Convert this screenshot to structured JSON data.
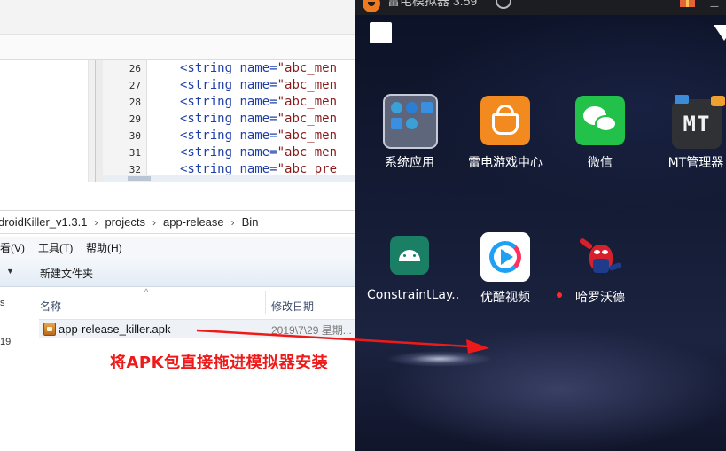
{
  "editor": {
    "lines": [
      {
        "num": "26",
        "prefix": "<string ",
        "attr": "name=",
        "value": "\"abc_men"
      },
      {
        "num": "27",
        "prefix": "<string ",
        "attr": "name=",
        "value": "\"abc_men"
      },
      {
        "num": "28",
        "prefix": "<string ",
        "attr": "name=",
        "value": "\"abc_men"
      },
      {
        "num": "29",
        "prefix": "<string ",
        "attr": "name=",
        "value": "\"abc_men"
      },
      {
        "num": "30",
        "prefix": "<string ",
        "attr": "name=",
        "value": "\"abc_men"
      },
      {
        "num": "31",
        "prefix": "<string ",
        "attr": "name=",
        "value": "\"abc_men"
      },
      {
        "num": "32",
        "prefix": "<string ",
        "attr": "name=",
        "value": "\"abc pre"
      }
    ]
  },
  "explorer": {
    "breadcrumb": [
      "droidKiller_v1.3.1",
      "projects",
      "app-release",
      "Bin"
    ],
    "breadcrumb_sep": "›",
    "menu": [
      "看(V)",
      "工具(T)",
      "帮助(H)"
    ],
    "toolbar": {
      "dropdown_glyph": "▼",
      "new_folder": "新建文件夹"
    },
    "nav_fragments": [
      "s",
      "19"
    ],
    "columns": {
      "name": "名称",
      "date": "修改日期",
      "sort_glyph": "^"
    },
    "files": [
      {
        "name": "app-release_killer.apk",
        "date": "2019\\7\\29 星期..."
      }
    ]
  },
  "emulator": {
    "title": "雷电模拟器 3.59",
    "apps": [
      {
        "label": "系统应用",
        "icon": "folder-icon"
      },
      {
        "label": "雷电游戏中心",
        "icon": "game-center-icon"
      },
      {
        "label": "微信",
        "icon": "wechat-icon"
      },
      {
        "label": "MT管理器",
        "icon": "mt-manager-icon",
        "icon_text": "MT"
      },
      {
        "label": "ConstraintLay..",
        "icon": "android-icon"
      },
      {
        "label": "优酷视频",
        "icon": "youku-icon"
      },
      {
        "label": "哈罗沃德",
        "icon": "spiderman-icon"
      }
    ]
  },
  "annotation": {
    "caption": "将APK包直接拖进模拟器安装",
    "color": "#ee1a1a"
  }
}
